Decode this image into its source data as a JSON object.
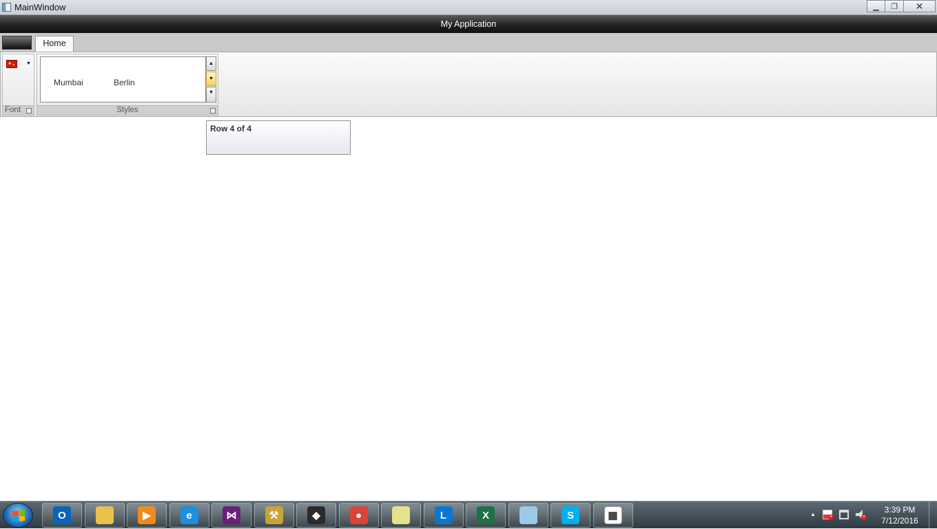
{
  "window": {
    "title": "MainWindow"
  },
  "app": {
    "header_title": "My Application"
  },
  "ribbon": {
    "tabs": [
      {
        "label": "Home"
      }
    ],
    "groups": {
      "font": {
        "caption": "Font"
      },
      "styles": {
        "caption": "Styles",
        "items": [
          {
            "label": "Mumbai"
          },
          {
            "label": "Berlin"
          }
        ]
      }
    }
  },
  "content": {
    "row_status": "Row 4 of 4"
  },
  "taskbar": {
    "apps": [
      {
        "name": "outlook",
        "letter": "O",
        "color": "#0a64b8"
      },
      {
        "name": "file-explorer",
        "letter": "",
        "color": "#e8c24a"
      },
      {
        "name": "media-player",
        "letter": "▶",
        "color": "#f08a1c"
      },
      {
        "name": "internet-explorer",
        "letter": "e",
        "color": "#1f8fe0"
      },
      {
        "name": "visual-studio",
        "letter": "⋈",
        "color": "#68217a"
      },
      {
        "name": "tools",
        "letter": "⚒",
        "color": "#c8a336"
      },
      {
        "name": "sql-server",
        "letter": "◆",
        "color": "#2b2b2b"
      },
      {
        "name": "chrome",
        "letter": "●",
        "color": "#db4437"
      },
      {
        "name": "sticky-notes",
        "letter": "",
        "color": "#e5e38a"
      },
      {
        "name": "lync",
        "letter": "L",
        "color": "#0a78d0"
      },
      {
        "name": "excel",
        "letter": "X",
        "color": "#1e7145"
      },
      {
        "name": "notepad-app",
        "letter": "",
        "color": "#9cc9e8"
      },
      {
        "name": "skype",
        "letter": "S",
        "color": "#00aff0"
      },
      {
        "name": "app-window",
        "letter": "▦",
        "color": "#ffffff"
      }
    ],
    "clock_time": "3:39 PM",
    "clock_date": "7/12/2016"
  }
}
